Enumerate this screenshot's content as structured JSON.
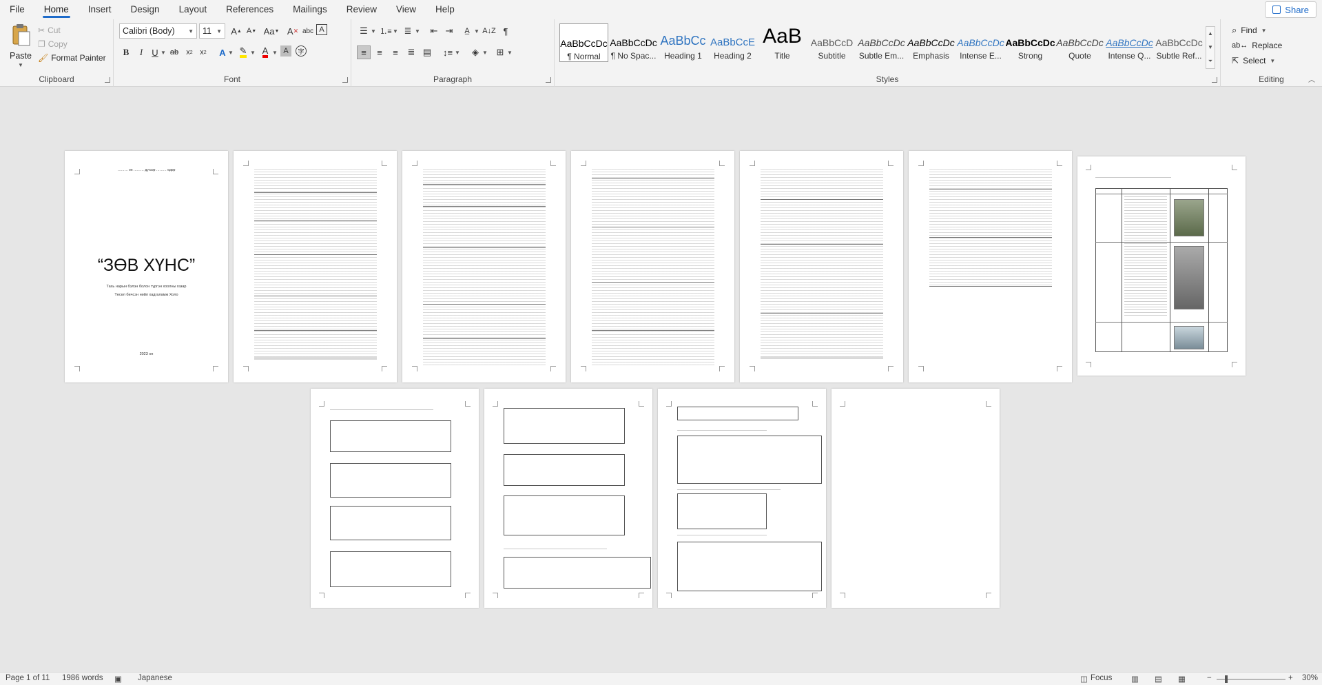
{
  "menu": {
    "tabs": [
      "File",
      "Home",
      "Insert",
      "Design",
      "Layout",
      "References",
      "Mailings",
      "Review",
      "View",
      "Help"
    ],
    "active": "Home",
    "share_label": "Share"
  },
  "clipboard": {
    "paste": "Paste",
    "cut": "Cut",
    "copy": "Copy",
    "format_painter": "Format Painter",
    "label": "Clipboard"
  },
  "font": {
    "family": "Calibri (Body)",
    "size": "11",
    "label": "Font"
  },
  "paragraph": {
    "label": "Paragraph"
  },
  "styles": {
    "label": "Styles",
    "items": [
      {
        "preview": "AaBbCcDc",
        "name": "¶ Normal",
        "selected": true
      },
      {
        "preview": "AaBbCcDc",
        "name": "¶ No Spac..."
      },
      {
        "preview": "AaBbCc",
        "name": "Heading 1"
      },
      {
        "preview": "AaBbCcE",
        "name": "Heading 2"
      },
      {
        "preview": "AaB",
        "name": "Title"
      },
      {
        "preview": "AaBbCcD",
        "name": "Subtitle"
      },
      {
        "preview": "AaBbCcDc",
        "name": "Subtle Em..."
      },
      {
        "preview": "AaBbCcDc",
        "name": "Emphasis"
      },
      {
        "preview": "AaBbCcDc",
        "name": "Intense E..."
      },
      {
        "preview": "AaBbCcDc",
        "name": "Strong"
      },
      {
        "preview": "AaBbCcDc",
        "name": "Quote"
      },
      {
        "preview": "AaBbCcDc",
        "name": "Intense Q..."
      },
      {
        "preview": "AaBbCcDc",
        "name": "Subtle Ref..."
      }
    ]
  },
  "editing": {
    "find": "Find",
    "replace": "Replace",
    "select": "Select",
    "label": "Editing"
  },
  "cover": {
    "date_line": "……… он ……… дүгээр ……… өдөр",
    "title": "“ЗӨВ ХҮНС”",
    "sub1": "Тахь нарын бэлэн болон түргэн хоолны газар",
    "sub2": "Төсөл бичсэн нөйл хадгаламж Холо",
    "year": "2023 он"
  },
  "status": {
    "page": "Page 1 of 11",
    "words": "1986 words",
    "language": "Japanese",
    "focus": "Focus",
    "zoom": "30%"
  },
  "colors": {
    "accent": "#1e6bc9",
    "ribbon_bg": "#f3f3f3",
    "doc_bg": "#e6e6e6"
  }
}
